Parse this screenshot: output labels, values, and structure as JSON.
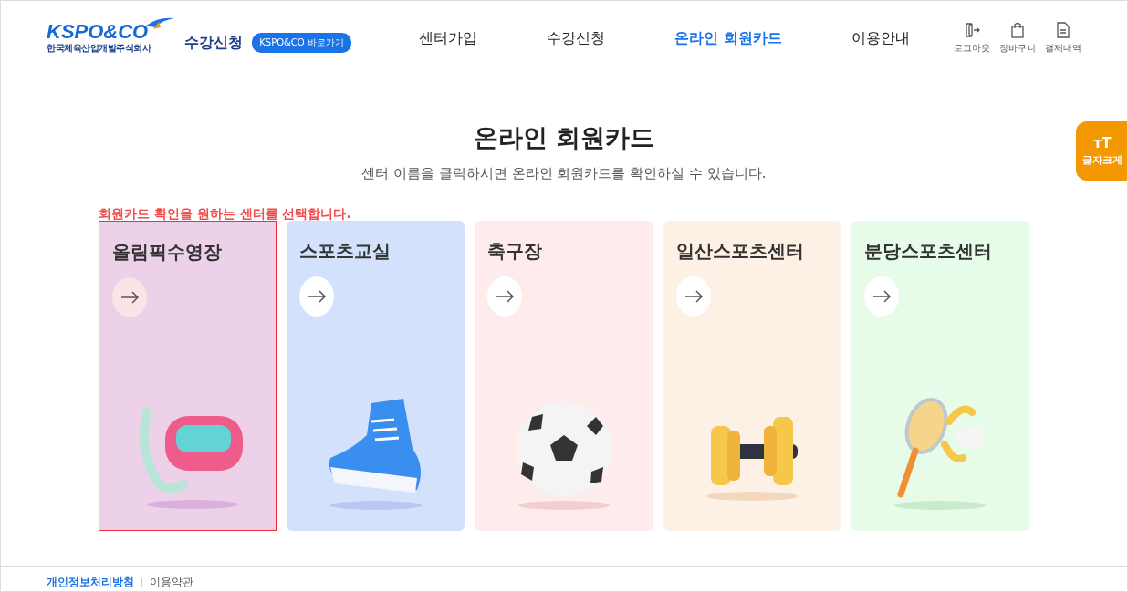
{
  "header": {
    "logo_text": "KSPO&CO",
    "company_name": "한국체육산업개발주식회사",
    "service_title": "수강신청",
    "shortcut_button": "KSPO&CO 바로가기",
    "nav": [
      {
        "label": "센터가입",
        "selected": false
      },
      {
        "label": "수강신청",
        "selected": false
      },
      {
        "label": "온라인 회원카드",
        "selected": true
      },
      {
        "label": "이용안내",
        "selected": false
      }
    ],
    "utility": [
      {
        "kind": "logout",
        "label": "로그아웃"
      },
      {
        "kind": "cart",
        "label": "장바구니"
      },
      {
        "kind": "receipt",
        "label": "결제내역"
      }
    ]
  },
  "font_size_button": {
    "icon_text": "ᴛT",
    "label": "글자크게"
  },
  "title": "온라인 회원카드",
  "subtitle": "센터 이름을 클릭하시면 온라인 회원카드를 확인하실 수 있습니다.",
  "instruction": "회원카드 확인을 원하는 센터를 선택합니다.",
  "centers": [
    {
      "name": "올림픽수영장",
      "kind": "goggles",
      "color": "#edd1e8",
      "selected": true
    },
    {
      "name": "스포츠교실",
      "kind": "sneaker",
      "color": "#d3e1fd",
      "selected": false
    },
    {
      "name": "축구장",
      "kind": "ball",
      "color": "#fdeceb",
      "selected": false
    },
    {
      "name": "일산스포츠센터",
      "kind": "dumbbell",
      "color": "#fdf0e4",
      "selected": false
    },
    {
      "name": "분당스포츠센터",
      "kind": "racket",
      "color": "#e6fbe8",
      "selected": false
    }
  ],
  "footer_links": [
    {
      "label": "개인정보처리방침",
      "kind": "primary"
    },
    {
      "label": "이용약관",
      "kind": "normal"
    }
  ]
}
